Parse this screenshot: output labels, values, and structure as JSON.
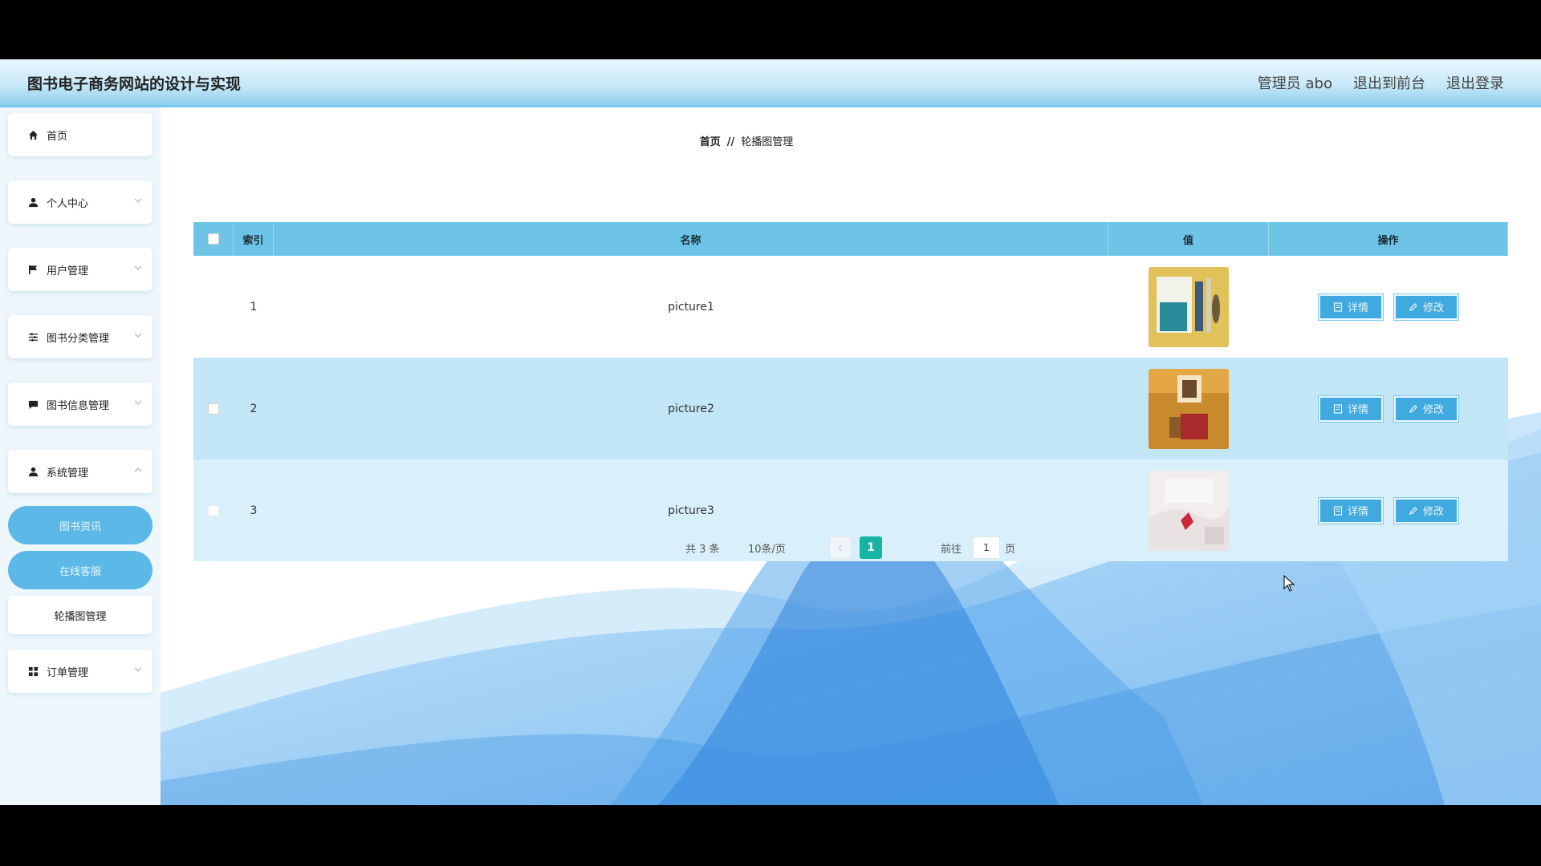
{
  "header": {
    "title": "图书电子商务网站的设计与实现",
    "admin": "管理员 abo",
    "exit_front": "退出到前台",
    "logout": "退出登录"
  },
  "sidebar": {
    "items": [
      {
        "label": "首页",
        "icon": "home-icon"
      },
      {
        "label": "个人中心",
        "icon": "user-icon"
      },
      {
        "label": "用户管理",
        "icon": "flag-icon"
      },
      {
        "label": "图书分类管理",
        "icon": "sliders-icon"
      },
      {
        "label": "图书信息管理",
        "icon": "chat-icon"
      },
      {
        "label": "系统管理",
        "icon": "user-icon"
      },
      {
        "label": "订单管理",
        "icon": "grid-icon"
      }
    ],
    "sub_items": [
      "图书资讯",
      "在线客服",
      "轮播图管理"
    ]
  },
  "breadcrumb": {
    "home": "首页",
    "sep": "//",
    "current": "轮播图管理"
  },
  "table": {
    "headers": {
      "index": "索引",
      "name": "名称",
      "value": "值",
      "operation": "操作"
    },
    "rows": [
      {
        "index": "1",
        "name": "picture1"
      },
      {
        "index": "2",
        "name": "picture2"
      },
      {
        "index": "3",
        "name": "picture3"
      }
    ],
    "detail_label": "详情",
    "edit_label": "修改"
  },
  "pagination": {
    "total": "共 3 条",
    "page_size": "10条/页",
    "current_page": "1",
    "goto_prefix": "前往",
    "goto_value": "1",
    "goto_suffix": "页"
  },
  "colors": {
    "header_bg": "#c9e9f8",
    "table_header": "#6ec4e6",
    "button": "#40a9e0",
    "active_page": "#17b3a3"
  }
}
